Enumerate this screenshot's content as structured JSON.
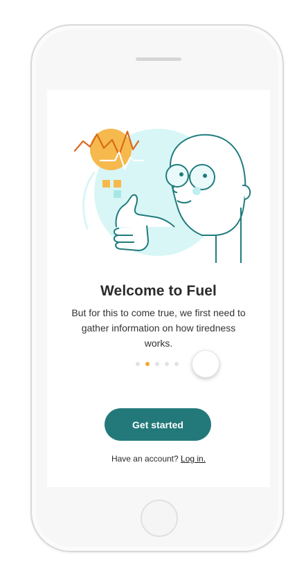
{
  "onboarding": {
    "title": "Welcome to Fuel",
    "subtitle": "But for this to come true, we first need to gather information on how tiredness works.",
    "pagination": {
      "total": 5,
      "active_index": 1
    },
    "cta_label": "Get started",
    "login_prompt": "Have an account?",
    "login_link": "Log in."
  },
  "colors": {
    "accent": "#23797a",
    "dot_active": "#f0a830",
    "dot_inactive": "#e2e2e2",
    "illustration_blob": "#d8f6f6",
    "illustration_sun": "#f6b94d",
    "illustration_line": "#1f7b7c"
  },
  "icons": {
    "illustration": "thumbs-up-character-illustration"
  }
}
